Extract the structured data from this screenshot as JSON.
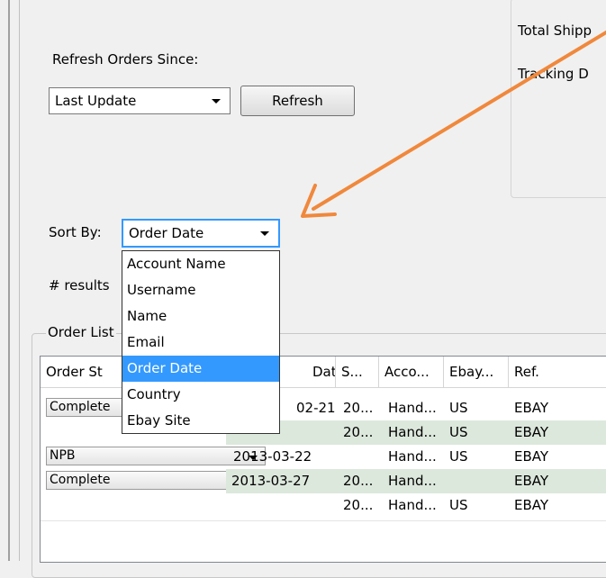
{
  "refresh": {
    "label": "Refresh Orders Since:",
    "select_value": "Last Update",
    "button": "Refresh"
  },
  "right_panel": {
    "total_shipping": "Total Shipp",
    "tracking": "Tracking D"
  },
  "sort": {
    "label": "Sort By:",
    "value": "Order Date",
    "options": [
      "Account Name",
      "Username",
      "Name",
      "Email",
      "Order Date",
      "Country",
      "Ebay Site"
    ],
    "selected_index": 4
  },
  "results_label": "# results",
  "order_list_label": "Order List",
  "table": {
    "headers": [
      "Order St",
      "Date",
      "S...",
      "Acco...",
      "Ebay...",
      "Ref."
    ],
    "rows": [
      {
        "status": "Complete",
        "date": "02-21",
        "s": "20...",
        "acct": "Hand...",
        "ebay": "US",
        "ref": "EBAY"
      },
      {
        "status": "",
        "date": "",
        "s": "20...",
        "acct": "Hand...",
        "ebay": "US",
        "ref": "EBAY"
      },
      {
        "status": "NPB",
        "date": "2013-03-22",
        "s": "",
        "acct": "Hand...",
        "ebay": "US",
        "ref": "EBAY"
      },
      {
        "status": "Complete",
        "date": "2013-03-27",
        "s": "20...",
        "acct": "Hand...",
        "ebay": "",
        "ref": "EBAY"
      },
      {
        "status": "",
        "date": "",
        "s": "20...",
        "acct": "Hand...",
        "ebay": "US",
        "ref": "EBAY"
      }
    ]
  },
  "annotation_color": "#f0883c"
}
